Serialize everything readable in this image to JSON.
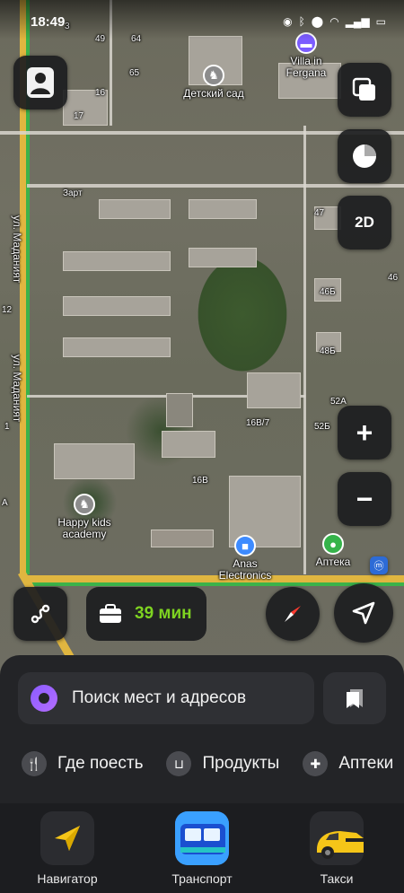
{
  "status_bar": {
    "time": "18:49"
  },
  "map": {
    "streets": [
      "ул. Маданият",
      "ул. Маданият",
      "Зарт"
    ],
    "house_numbers": [
      "3",
      "49",
      "64",
      "65",
      "16",
      "17",
      "47",
      "46Б",
      "46",
      "46Б",
      "48Б",
      "52А",
      "52Б",
      "16В/7",
      "16В",
      "А",
      "12",
      "1"
    ],
    "pois": [
      {
        "name": "Детский сад",
        "icon": "rocking-horse-icon",
        "color": "#8c8c8c"
      },
      {
        "name": "Villa in Fergana",
        "icon": "bed-icon",
        "color": "#7b5cff"
      },
      {
        "name": "Happy kids academy",
        "icon": "rocking-horse-icon",
        "color": "#8c8c8c"
      },
      {
        "name": "Anas Electronics",
        "icon": "shopping-bag-icon",
        "color": "#3d8bff"
      },
      {
        "name": "Аптека",
        "icon": "pill-icon",
        "color": "#35b34a"
      }
    ]
  },
  "controls": {
    "layers_icon": "layers-icon",
    "mode_label": "2D",
    "zoom_in": "+",
    "zoom_out": "−",
    "traffic_time": "39 мин"
  },
  "sheet": {
    "search_placeholder": "Поиск мест и адресов",
    "chips": [
      {
        "label": "Где поесть",
        "icon": "fork-knife-icon"
      },
      {
        "label": "Продукты",
        "icon": "basket-icon"
      },
      {
        "label": "Аптеки",
        "icon": "plus-icon"
      }
    ]
  },
  "apps": [
    {
      "label": "Навигатор",
      "icon": "navigator-icon"
    },
    {
      "label": "Транспорт",
      "icon": "bus-icon"
    },
    {
      "label": "Такси",
      "icon": "taxi-icon"
    }
  ],
  "colors": {
    "accent_green": "#7ed321",
    "road_yellow": "#e0b640",
    "road_green": "#3cb24a",
    "alice_purple": "#8a5cff"
  }
}
